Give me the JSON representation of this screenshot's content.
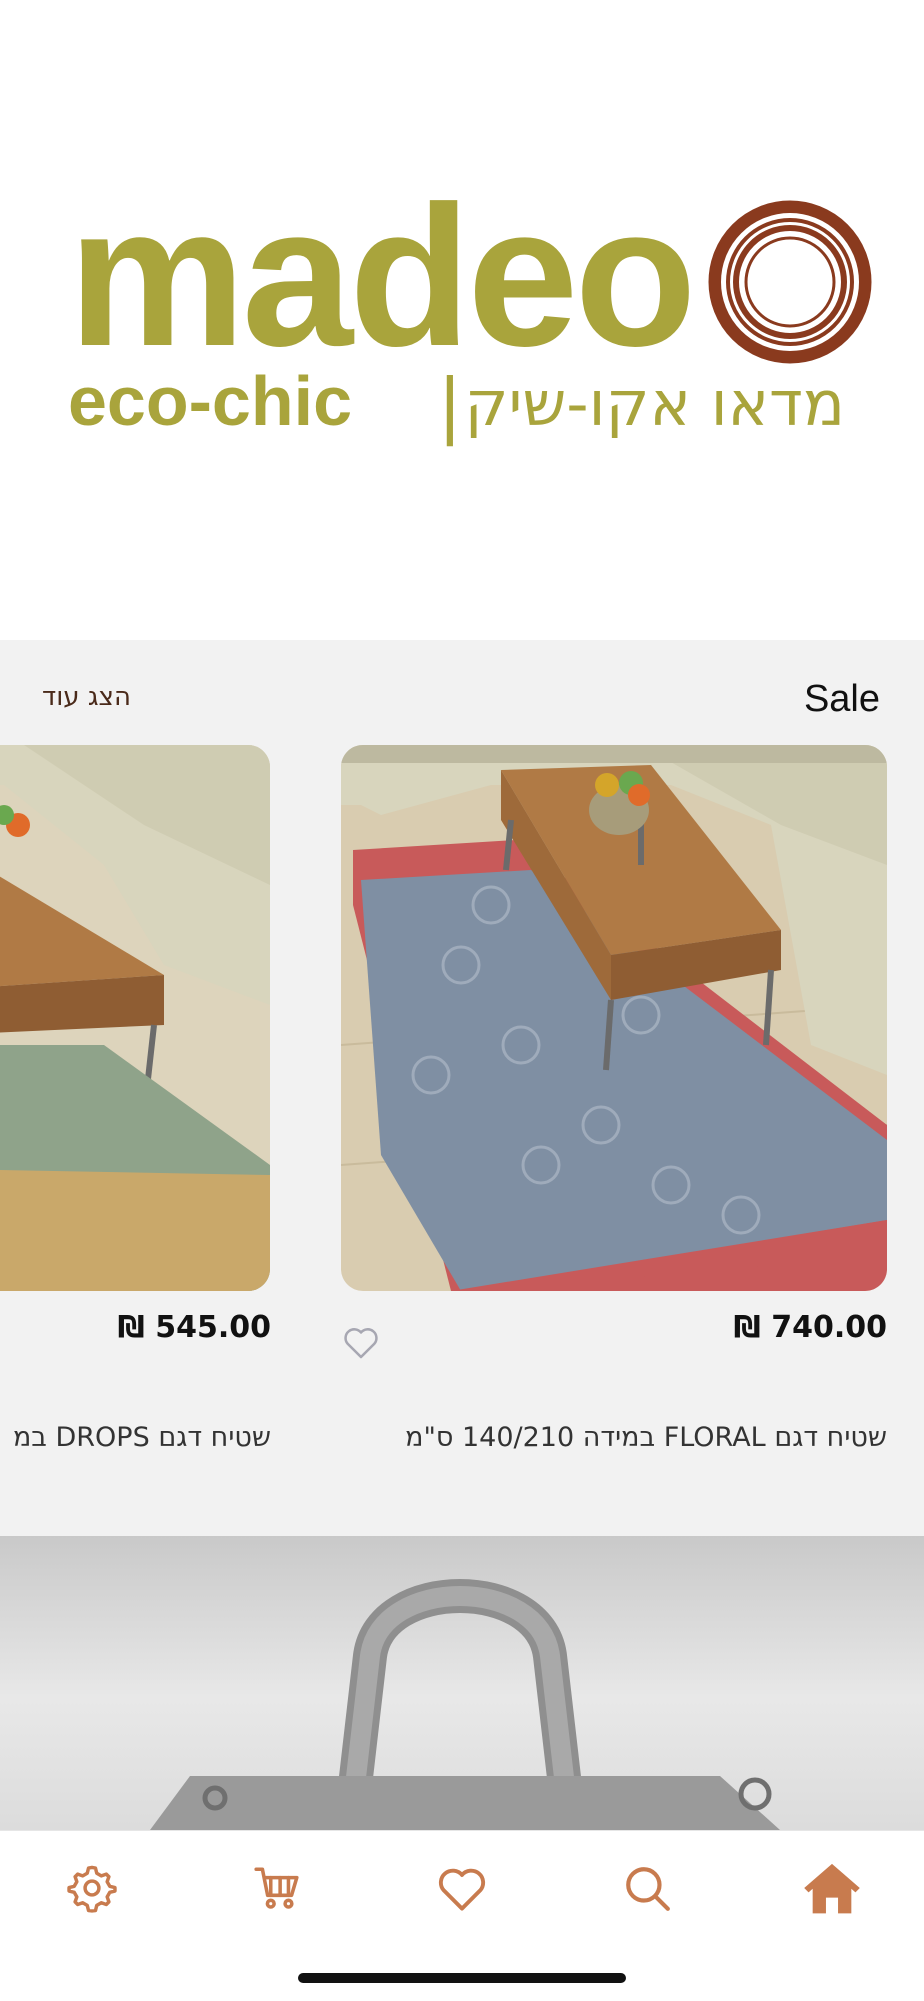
{
  "brand": {
    "name": "madeo",
    "tagline_en": "eco-chic",
    "separator": "|",
    "tagline_he": "מדאו אקו-שיק",
    "colors": {
      "olive": "#a9a43c",
      "rust": "#8a3a1e"
    }
  },
  "sale_section": {
    "title": "Sale",
    "show_more": "הצג עוד",
    "products": [
      {
        "name": "שטיח דגם FLORAL במידה 140/210 ס\"מ",
        "price": "₪ 740.00",
        "favorite_icon": "heart-outline-icon"
      },
      {
        "name": "שטיח דגם DROPS במ",
        "price": "₪ 545.00"
      }
    ]
  },
  "nav": {
    "items": [
      {
        "name": "settings",
        "icon": "gear-icon"
      },
      {
        "name": "cart",
        "icon": "cart-icon"
      },
      {
        "name": "favorites",
        "icon": "heart-icon"
      },
      {
        "name": "search",
        "icon": "search-icon"
      },
      {
        "name": "home",
        "icon": "home-icon"
      }
    ],
    "accent": "#c87b4e"
  }
}
